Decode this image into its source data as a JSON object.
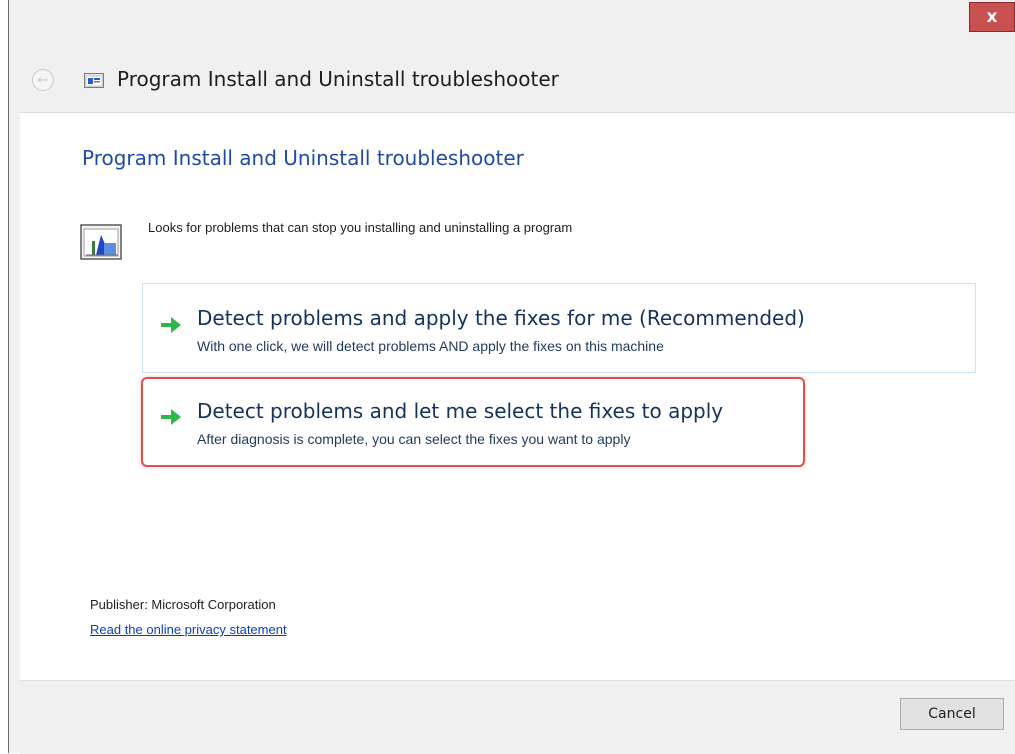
{
  "window": {
    "title": "Program Install and Uninstall troubleshooter",
    "close_label": "x",
    "back_icon": "back-arrow-icon",
    "title_icon": "troubleshooter-app-icon"
  },
  "content": {
    "heading": "Program Install and Uninstall troubleshooter",
    "description": "Looks for problems that can stop you installing and uninstalling a program",
    "description_icon": "program-install-icon"
  },
  "options": [
    {
      "title": "Detect problems and apply the fixes for me (Recommended)",
      "subtitle": "With one click, we will detect problems AND apply the fixes on this machine",
      "icon": "green-arrow-icon"
    },
    {
      "title": "Detect problems and let me select the fixes to apply",
      "subtitle": "After diagnosis is complete, you can select the fixes you want to apply",
      "icon": "green-arrow-icon"
    }
  ],
  "footer_info": {
    "publisher": "Publisher: Microsoft Corporation",
    "privacy_link": "Read the online privacy statement"
  },
  "buttons": {
    "cancel": "Cancel"
  },
  "colors": {
    "heading": "#1f4ba8",
    "link": "#0b3fb8",
    "close_button": "#c75050",
    "highlight_border": "#d9534f",
    "arrow": "#2fb84a"
  }
}
